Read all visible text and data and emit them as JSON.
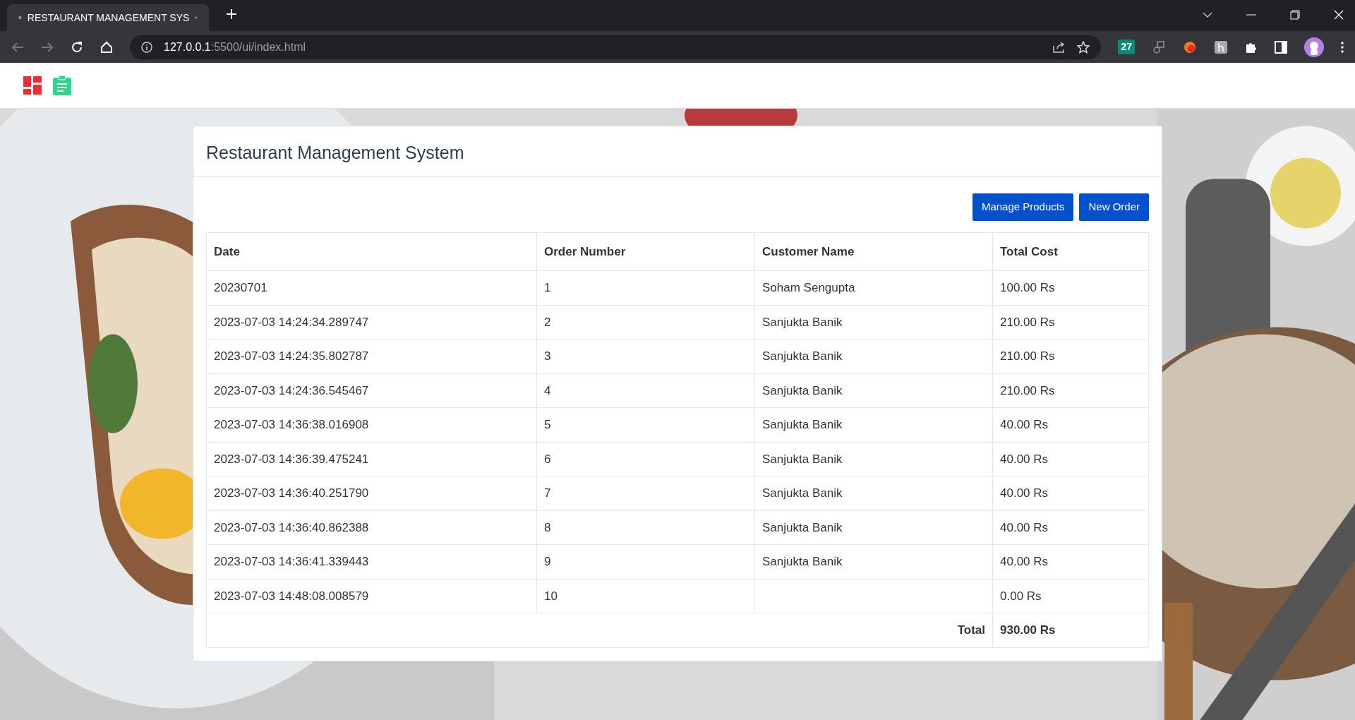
{
  "browser": {
    "tab_title": "RESTAURANT MANAGEMENT SYS",
    "url_host": "127.0.0.1",
    "url_path": ":5500/ui/index.html",
    "extension_badge": "27"
  },
  "card": {
    "title": "Restaurant Management System"
  },
  "buttons": [
    "Manage Products",
    "New Order"
  ],
  "table": {
    "columns": [
      "Date",
      "Order Number",
      "Customer Name",
      "Total Cost"
    ],
    "rows": [
      [
        "20230701",
        "1",
        "Soham Sengupta",
        "100.00 Rs"
      ],
      [
        "2023-07-03 14:24:34.289747",
        "2",
        "Sanjukta Banik",
        "210.00 Rs"
      ],
      [
        "2023-07-03 14:24:35.802787",
        "3",
        "Sanjukta Banik",
        "210.00 Rs"
      ],
      [
        "2023-07-03 14:24:36.545467",
        "4",
        "Sanjukta Banik",
        "210.00 Rs"
      ],
      [
        "2023-07-03 14:36:38.016908",
        "5",
        "Sanjukta Banik",
        "40.00 Rs"
      ],
      [
        "2023-07-03 14:36:39.475241",
        "6",
        "Sanjukta Banik",
        "40.00 Rs"
      ],
      [
        "2023-07-03 14:36:40.251790",
        "7",
        "Sanjukta Banik",
        "40.00 Rs"
      ],
      [
        "2023-07-03 14:36:40.862388",
        "8",
        "Sanjukta Banik",
        "40.00 Rs"
      ],
      [
        "2023-07-03 14:36:41.339443",
        "9",
        "Sanjukta Banik",
        "40.00 Rs"
      ],
      [
        "2023-07-03 14:48:08.008579",
        "10",
        "",
        "0.00 Rs"
      ]
    ],
    "total_label": "Total",
    "total_value": "930.00 Rs"
  }
}
